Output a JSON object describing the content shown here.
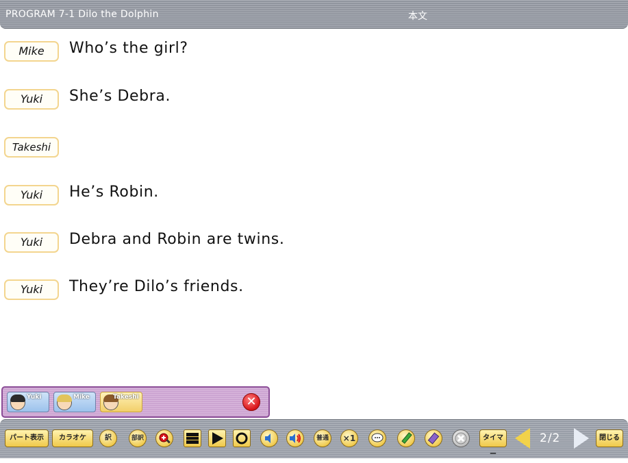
{
  "header": {
    "title": "PROGRAM 7-1 Dilo the Dolphin",
    "section": "本文"
  },
  "dialogue": [
    {
      "speaker": "Mike",
      "text": "Who’s the girl?"
    },
    {
      "speaker": "Yuki",
      "text": "She’s Debra."
    },
    {
      "speaker": "Takeshi",
      "text": ""
    },
    {
      "speaker": "Yuki",
      "text": "He’s Robin."
    },
    {
      "speaker": "Yuki",
      "text": "Debra and Robin are twins."
    },
    {
      "speaker": "Yuki",
      "text": "They’re Dilo’s friends."
    }
  ],
  "characters": [
    {
      "name": "Yuki",
      "state": "selected"
    },
    {
      "name": "Mike",
      "state": "selected"
    },
    {
      "name": "Takeshi",
      "state": "unselected"
    }
  ],
  "toolbar": {
    "part_display": "パート表示",
    "karaoke": "カラオケ",
    "translate": "訳",
    "partial_translate": "部訳",
    "speed_normal": "普通",
    "speed_x1": "×1",
    "timer": "タイマー",
    "page": "2/2",
    "close": "閉じる"
  },
  "colors": {
    "accent_yellow": "#f0c94a",
    "panel_purple": "#c9a0cf",
    "close_red": "#d8141a"
  },
  "icons": [
    "zoom-in-icon",
    "stop-icon",
    "play-icon",
    "repeat-icon",
    "volume-down-icon",
    "volume-up-icon",
    "speech-bubble-icon",
    "pencil-icon",
    "eraser-icon",
    "clear-icon",
    "prev-arrow-icon",
    "next-arrow-icon",
    "close-icon"
  ]
}
